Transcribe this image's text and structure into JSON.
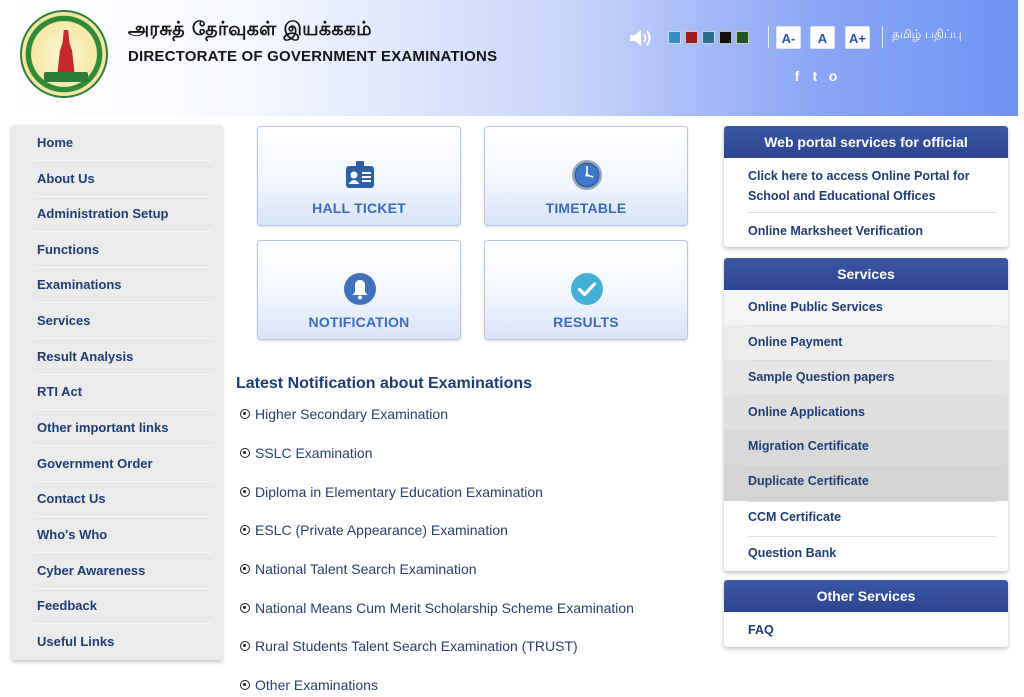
{
  "header": {
    "title_tamil": "அரசுத் தேர்வுகள் இயக்ககம்",
    "title_english": "DIRECTORATE OF GOVERNMENT EXAMINATIONS",
    "font_decrease": "A-",
    "font_normal": "A",
    "font_increase": "A+",
    "language_toggle": "தமிழ் பதிப்பு",
    "theme_colors": [
      "#3a8ac9",
      "#9c1c1c",
      "#2d6e8c",
      "#0f0f0f",
      "#24531f"
    ],
    "social": [
      "f",
      "t",
      "o"
    ]
  },
  "nav": {
    "items": [
      "Home",
      "About Us",
      "Administration Setup",
      "Functions",
      "Examinations",
      "Services",
      "Result Analysis",
      "RTI Act",
      "Other important links",
      "Government Order",
      "Contact Us",
      "Who's Who",
      "Cyber Awareness",
      "Feedback",
      "Useful Links"
    ]
  },
  "tiles": {
    "hall_ticket": "HALL TICKET",
    "timetable": "TIMETABLE",
    "notification": "NOTIFICATION",
    "results": "RESULTS"
  },
  "notifications": {
    "title": "Latest Notification about Examinations",
    "items": [
      "Higher Secondary Examination",
      "SSLC Examination",
      "Diploma in Elementary Education Examination",
      "ESLC (Private Appearance) Examination",
      "National Talent Search Examination",
      "National Means Cum Merit Scholarship Scheme Examination",
      "Rural Students Talent Search Examination (TRUST)",
      "Other Examinations"
    ]
  },
  "portal": {
    "title": "Web portal services for official",
    "link1_line1": "Click here to access Online Portal for",
    "link1_line2": "School and Educational Offices",
    "link2": "Online Marksheet Verification"
  },
  "services": {
    "title": "Services",
    "items": [
      "Online Public Services",
      "Online Payment",
      "Sample Question papers",
      "Online Applications",
      "Migration Certificate",
      "Duplicate Certificate",
      "CCM Certificate",
      "Question Bank"
    ]
  },
  "other_services": {
    "title": "Other Services",
    "items": [
      "FAQ"
    ]
  }
}
